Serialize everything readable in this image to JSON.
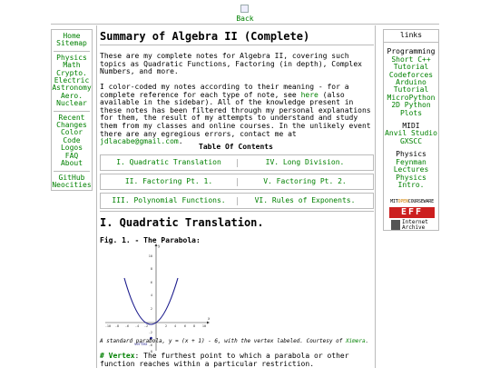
{
  "top": {
    "back_label": "Back"
  },
  "sidebar_left": {
    "group1": [
      "Home",
      "Sitemap"
    ],
    "group2": [
      "Physics",
      "Math",
      "Crypto.",
      "Electric",
      "Astronomy",
      "Aero.",
      "Nuclear"
    ],
    "group3": [
      "Recent",
      "Changes",
      "Color",
      "Code",
      "Logos",
      "FAQ",
      "About"
    ],
    "group4": [
      "GitHub",
      "Neocities"
    ]
  },
  "sidebar_right": {
    "header": "links",
    "programming_heading": "Programming",
    "programming": [
      "Short C++",
      "Tutorial",
      "Codeforces",
      "Arduino",
      "Tutorial",
      "MicroPython",
      "2D Python",
      "Plots"
    ],
    "midi_heading": "MIDI",
    "midi": [
      "Anvil Studio",
      "GXSCC"
    ],
    "physics_heading": "Physics",
    "physics": [
      "Feynman",
      "Lectures",
      "Physics",
      "Intro."
    ],
    "badges": {
      "mit_a": "MIT",
      "mit_b": "OPEN",
      "mit_c": "COURSEWARE",
      "eff": "EFF",
      "archive": "Internet Archive"
    }
  },
  "main": {
    "title": "Summary of Algebra II (Complete)",
    "p1": "These are my complete notes for Algebra II, covering such topics as Quadratic Functions, Factoring (in depth), Complex Numbers, and more.",
    "p2_a": "I color-coded my notes according to their meaning - for a complete reference for each type of note, see ",
    "p2_link": "here",
    "p2_b": " (also available in the sidebar). All of the knowledge present in these notes has been filtered through my personal explanations for them, the result of my attempts to understand and study them from my classes and online courses. In the unlikely event there are any egregious errors, contact me at ",
    "p2_email": "jdlacabe@gmail.com",
    "p2_c": ".",
    "toc_title": "Table Of Contents",
    "toc": [
      [
        "I. Quadratic Translation",
        "IV. Long Division."
      ],
      [
        "II. Factoring Pt. 1.",
        "V. Factoring Pt. 2."
      ],
      [
        "III. Polynomial Functions.",
        "VI. Rules of Exponents."
      ]
    ],
    "section_title": "I. Quadratic Translation.",
    "fig_title": "Fig. 1. - The Parabola:",
    "plot": {
      "x_label": "x",
      "y_label": "y",
      "vertex_label": "vertex",
      "x_ticks": [
        "-10",
        "-8",
        "-6",
        "-4",
        "-2",
        "2",
        "4",
        "6",
        "8",
        "10"
      ],
      "y_ticks": [
        "10",
        "8",
        "6",
        "4",
        "2",
        "-2",
        "-4",
        "-6",
        "-8"
      ]
    },
    "caption_a": "A standard parabola, y = (x + 1) - 6, with the vertex labeled. Courtesy of ",
    "caption_link": "Ximera",
    "caption_b": ".",
    "p3_term": "# Vertex",
    "p3_text": ": The furthest point to which a parabola or other function reaches within a particular restriction."
  }
}
